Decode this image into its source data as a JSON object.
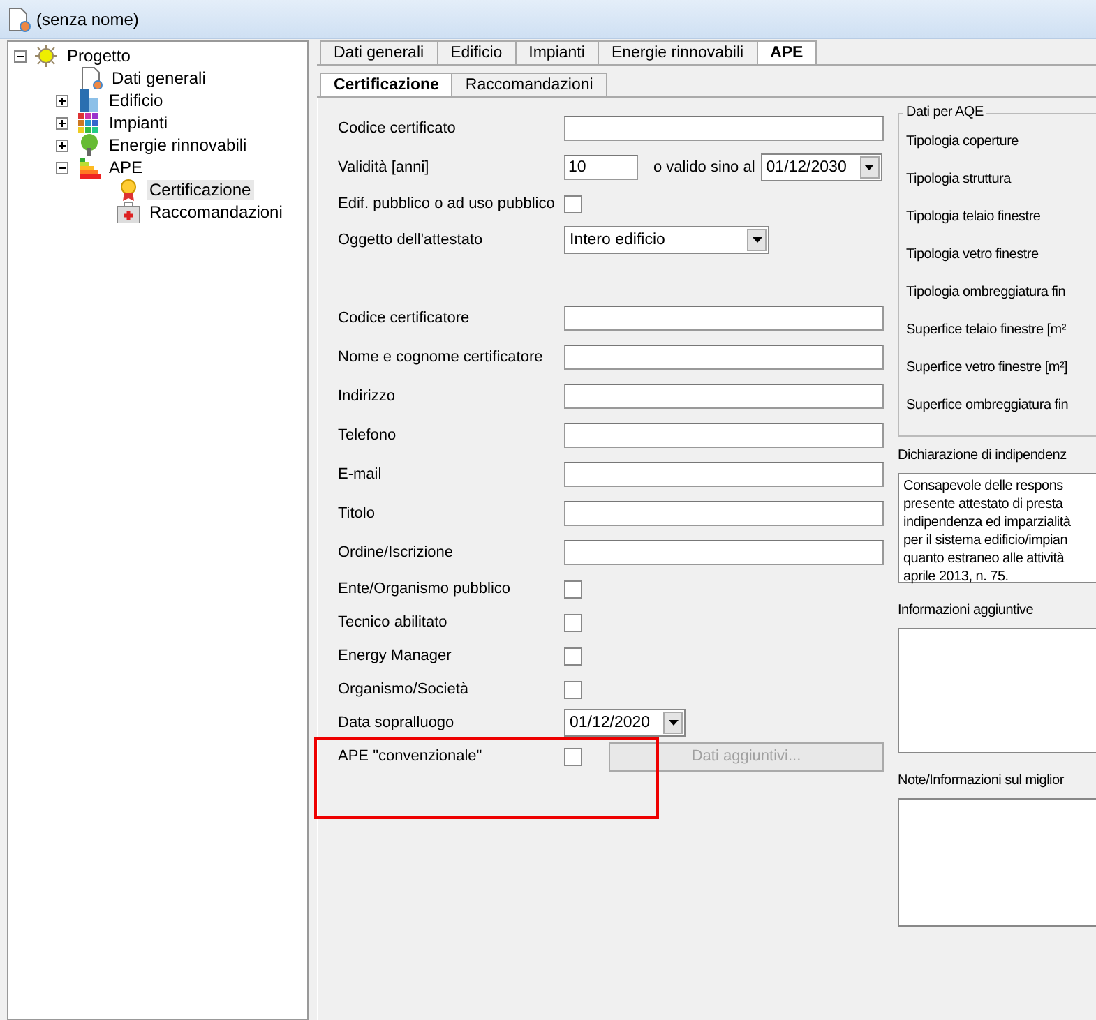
{
  "window": {
    "title": "(senza nome)"
  },
  "tree": [
    {
      "label": "Progetto",
      "kind": "sun",
      "expanded": true,
      "selected": false,
      "children": [
        {
          "label": "Dati generali",
          "kind": "document",
          "selected": false
        },
        {
          "label": "Edificio",
          "kind": "building",
          "expanded": false,
          "selected": false
        },
        {
          "label": "Impianti",
          "kind": "grid",
          "expanded": false,
          "selected": false
        },
        {
          "label": "Energie rinnovabili",
          "kind": "tree",
          "expanded": false,
          "selected": false
        },
        {
          "label": "APE",
          "kind": "energy",
          "expanded": true,
          "selected": false,
          "children": [
            {
              "label": "Certificazione",
              "kind": "award",
              "selected": true
            },
            {
              "label": "Raccomandazioni",
              "kind": "kit",
              "selected": false
            }
          ]
        }
      ]
    }
  ],
  "tabs": [
    {
      "label": "Dati generali",
      "selected": false
    },
    {
      "label": "Edificio",
      "selected": false
    },
    {
      "label": "Impianti",
      "selected": false
    },
    {
      "label": "Energie rinnovabili",
      "selected": false
    },
    {
      "label": "APE",
      "selected": true
    }
  ],
  "subtabs": [
    {
      "label": "Certificazione",
      "selected": true
    },
    {
      "label": "Raccomandazioni",
      "selected": false
    }
  ],
  "form": [
    {
      "kind": "text",
      "label": "Codice certificato"
    },
    {
      "kind": "validity",
      "label": "Validità [anni]",
      "value": "10",
      "connector": "o valido sino al",
      "date": "01/12/2030"
    },
    {
      "kind": "checkbox",
      "label": "Edif. pubblico o ad uso pubblico",
      "checked": false
    },
    {
      "kind": "select",
      "label": "Oggetto dell'attestato",
      "value": "Intero edificio"
    },
    {
      "kind": "spacer"
    },
    {
      "kind": "text",
      "label": "Codice certificatore"
    },
    {
      "kind": "text",
      "label": "Nome e cognome certificatore"
    },
    {
      "kind": "text",
      "label": "Indirizzo"
    },
    {
      "kind": "text",
      "label": "Telefono"
    },
    {
      "kind": "text",
      "label": "E-mail"
    },
    {
      "kind": "text",
      "label": "Titolo"
    },
    {
      "kind": "text",
      "label": "Ordine/Iscrizione"
    },
    {
      "kind": "checkbox",
      "label": "Ente/Organismo pubblico",
      "checked": false
    },
    {
      "kind": "checkbox",
      "label": "Tecnico abilitato",
      "checked": false
    },
    {
      "kind": "checkbox",
      "label": "Energy Manager",
      "checked": false
    },
    {
      "kind": "checkbox",
      "label": "Organismo/Società",
      "checked": false
    },
    {
      "kind": "date",
      "label": "Data sopralluogo",
      "value": "01/12/2020"
    },
    {
      "kind": "checkbox_button",
      "label": "APE \"convenzionale\"",
      "checked": false,
      "button": "Dati aggiuntivi...",
      "button_disabled": true,
      "highlighted": true
    }
  ],
  "aqe": {
    "title": "Dati per AQE",
    "items": [
      "Tipologia coperture",
      "Tipologia struttura",
      "Tipologia telaio finestre",
      "Tipologia vetro finestre",
      "Tipologia ombreggiatura fin",
      "Superfice telaio finestre [m²",
      "Superfice vetro finestre [m²]",
      "Superfice ombreggiatura fin"
    ]
  },
  "declaration": {
    "label": "Dichiarazione di indipendenz",
    "text": "Consapevole delle respons\npresente attestato di presta\nindipendenza ed imparzialità\nper il sistema edificio/impian\nquanto estraneo alle attività\naprile 2013, n. 75."
  },
  "info": {
    "label": "Informazioni aggiuntive"
  },
  "notes": {
    "label": "Note/Informazioni sul miglior"
  }
}
